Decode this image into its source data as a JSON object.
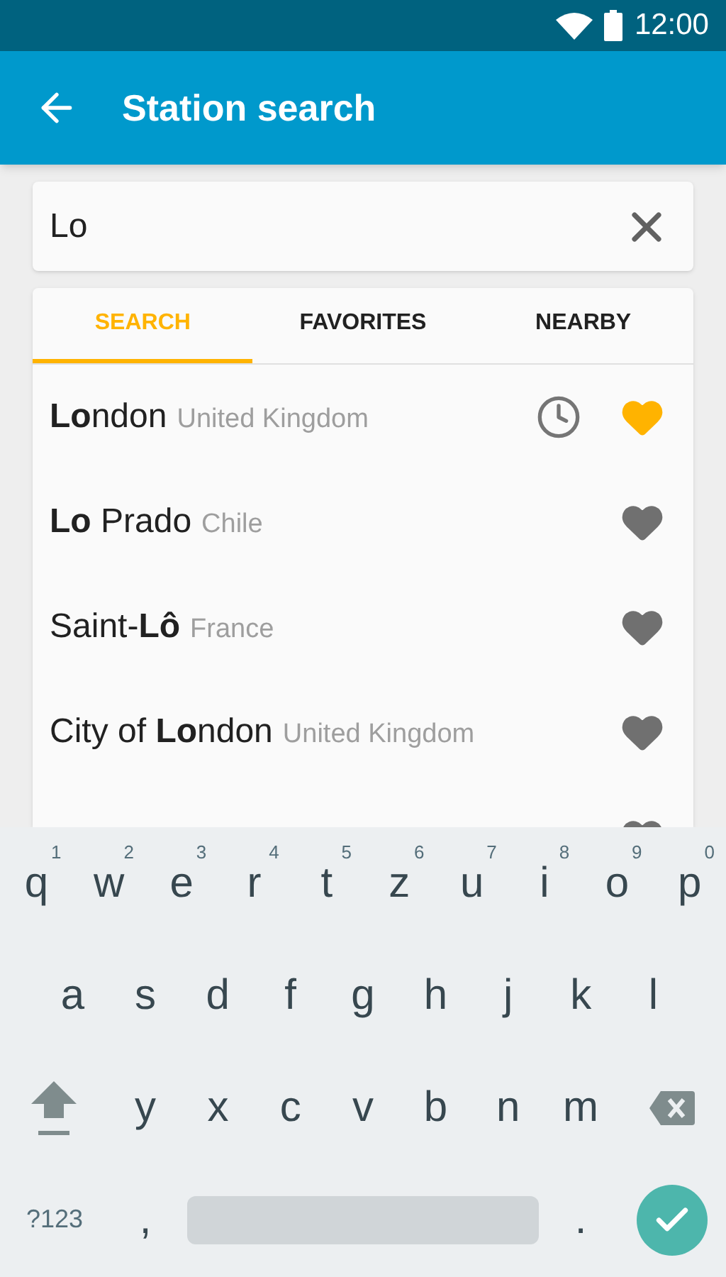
{
  "status_bar": {
    "time": "12:00"
  },
  "app_bar": {
    "title": "Station search"
  },
  "search": {
    "value": "Lo"
  },
  "tabs": [
    {
      "label": "SEARCH",
      "selected": true
    },
    {
      "label": "FAVORITES",
      "selected": false
    },
    {
      "label": "NEARBY",
      "selected": false
    }
  ],
  "results": [
    {
      "name": "**Lo**ndon",
      "country": "United Kingdom",
      "recent": true,
      "favorite": true
    },
    {
      "name": "**Lo** Prado",
      "country": "Chile",
      "recent": false,
      "favorite": false
    },
    {
      "name": "Saint-**Lô**",
      "country": "France",
      "recent": false,
      "favorite": false
    },
    {
      "name": "City of **Lo**ndon",
      "country": "United Kingdom",
      "recent": false,
      "favorite": false
    },
    {
      "favorite": false
    }
  ],
  "keyboard": {
    "rows": [
      [
        {
          "kind": "letter",
          "label": "q",
          "hint": "1"
        },
        {
          "kind": "letter",
          "label": "w",
          "hint": "2"
        },
        {
          "kind": "letter",
          "label": "e",
          "hint": "3"
        },
        {
          "kind": "letter",
          "label": "r",
          "hint": "4"
        },
        {
          "kind": "letter",
          "label": "t",
          "hint": "5"
        },
        {
          "kind": "letter",
          "label": "z",
          "hint": "6"
        },
        {
          "kind": "letter",
          "label": "u",
          "hint": "7"
        },
        {
          "kind": "letter",
          "label": "i",
          "hint": "8"
        },
        {
          "kind": "letter",
          "label": "o",
          "hint": "9"
        },
        {
          "kind": "letter",
          "label": "p",
          "hint": "0"
        }
      ],
      [
        {
          "kind": "letter",
          "label": "a"
        },
        {
          "kind": "letter",
          "label": "s"
        },
        {
          "kind": "letter",
          "label": "d"
        },
        {
          "kind": "letter",
          "label": "f"
        },
        {
          "kind": "letter",
          "label": "g"
        },
        {
          "kind": "letter",
          "label": "h"
        },
        {
          "kind": "letter",
          "label": "j"
        },
        {
          "kind": "letter",
          "label": "k"
        },
        {
          "kind": "letter",
          "label": "l"
        }
      ],
      [
        {
          "kind": "shift"
        },
        {
          "kind": "letter",
          "label": "y"
        },
        {
          "kind": "letter",
          "label": "x"
        },
        {
          "kind": "letter",
          "label": "c"
        },
        {
          "kind": "letter",
          "label": "v"
        },
        {
          "kind": "letter",
          "label": "b"
        },
        {
          "kind": "letter",
          "label": "n"
        },
        {
          "kind": "letter",
          "label": "m"
        },
        {
          "kind": "backspace"
        }
      ]
    ],
    "bottom_row": {
      "symbols_key": "?123",
      "comma_key": ",",
      "period_key": "."
    }
  }
}
